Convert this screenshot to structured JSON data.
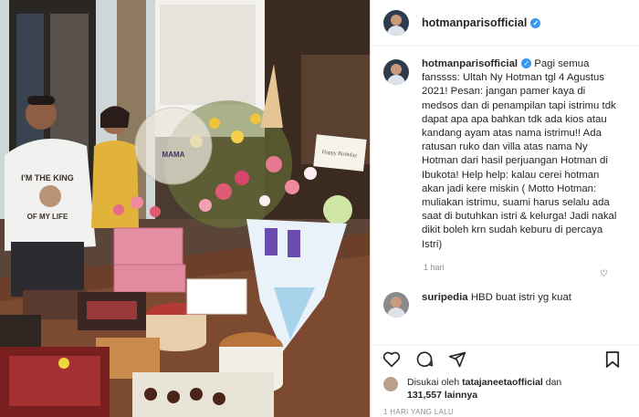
{
  "post": {
    "username": "hotmanparisofficial",
    "verified_icon": "verified-badge-icon",
    "caption": "Pagi semua fanssss: Ultah Ny Hotman tgl 4 Agustus 2021! Pesan: jangan pamer kaya di medsos dan di penampilan tapi istrimu tdk dapat apa apa bahkan tdk ada kios atau kandang ayam atas nama istrimu!! Ada ratusan ruko dan villa atas nama Ny Hotman dari hasil perjuangan Hotman di Ibukota! Help help: kalau cerei hotman akan jadi kere miskin ( Motto Hotman: muliakan istrimu, suami harus selalu ada saat di butuhkan istri & kelurga! Jadi nakal dikit boleh krn sudah keburu di percaya Istri)",
    "caption_time": "1 hari",
    "comment": {
      "username": "suripedia",
      "text": "HBD buat istri yg kuat"
    },
    "likes_prefix": "Disukai oleh",
    "likes_user": "tatajaneetaofficial",
    "likes_mid": "dan",
    "likes_count": "131,557",
    "likes_suffix": "lainnya",
    "timestamp": "1 HARI YANG LALU"
  },
  "photo": {
    "shirt_text_1": "I'M THE KING",
    "shirt_text_2": "OF MY LIFE",
    "balloon_text": "MAMA",
    "card_text": "Happy Birthday"
  },
  "icons": [
    "heart-icon",
    "comment-icon",
    "share-icon",
    "bookmark-icon"
  ],
  "colors": {
    "accent": "#3897f0",
    "text": "#262626",
    "muted": "#8e8e8e"
  }
}
